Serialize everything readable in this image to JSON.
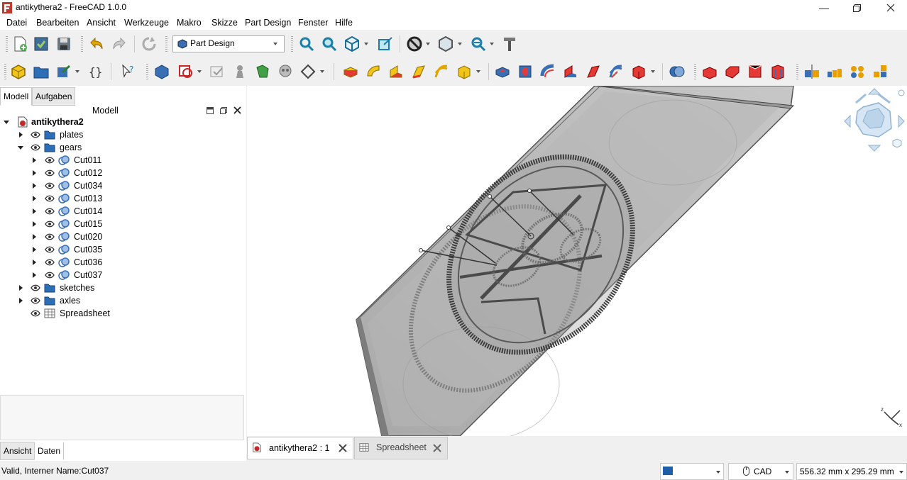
{
  "window": {
    "title": "antikythera2 - FreeCAD 1.0.0"
  },
  "menu": [
    "Datei",
    "Bearbeiten",
    "Ansicht",
    "Werkzeuge",
    "Makro",
    "Skizze",
    "Part Design",
    "Fenster",
    "Hilfe"
  ],
  "toolbar": {
    "workbench": "Part Design"
  },
  "panel": {
    "tabs": [
      "Modell",
      "Aufgaben"
    ],
    "header": "Modell",
    "bottom_tabs": [
      "Ansicht",
      "Daten"
    ]
  },
  "tree": {
    "document": "antikythera2",
    "groups": [
      {
        "label": "plates"
      },
      {
        "label": "gears"
      },
      {
        "label": "sketches"
      },
      {
        "label": "axles"
      }
    ],
    "gear_items": [
      "Cut011",
      "Cut012",
      "Cut034",
      "Cut013",
      "Cut014",
      "Cut015",
      "Cut020",
      "Cut035",
      "Cut036",
      "Cut037"
    ],
    "spreadsheet": "Spreadsheet"
  },
  "viewport": {
    "axis_x": "x",
    "axis_z": "z"
  },
  "doc_tabs": [
    "antikythera2 : 1",
    "Spreadsheet"
  ],
  "status": {
    "message": "Valid, Interner Name:Cut037",
    "nav_style": "CAD",
    "dimensions": "556.32 mm x 295.29 mm"
  },
  "colors": {
    "accent": "#1f5fa8",
    "folder": "#2d6fb6",
    "gear_gray": "#555555"
  }
}
